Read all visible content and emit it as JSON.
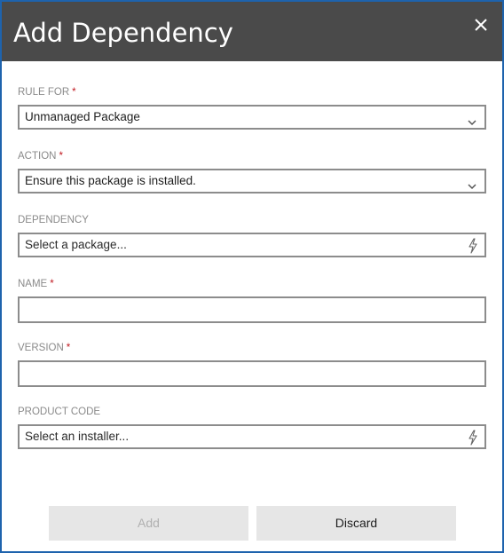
{
  "dialog": {
    "title": "Add Dependency",
    "close_icon": "close-icon"
  },
  "fields": {
    "rule_for": {
      "label": "RULE FOR",
      "required": "*",
      "value": "Unmanaged Package",
      "icon": "chevron-down-icon"
    },
    "action": {
      "label": "ACTION",
      "required": "*",
      "value": "Ensure this package is installed.",
      "icon": "chevron-down-icon"
    },
    "dependency": {
      "label": "DEPENDENCY",
      "value": "Select a package...",
      "icon": "lightning-bolt-icon"
    },
    "name": {
      "label": "NAME",
      "required": "*",
      "value": ""
    },
    "version": {
      "label": "VERSION",
      "required": "*",
      "value": ""
    },
    "product_code": {
      "label": "PRODUCT CODE",
      "value": "Select an installer...",
      "icon": "lightning-bolt-icon"
    }
  },
  "buttons": {
    "add_label": "Add",
    "discard_label": "Discard"
  },
  "colors": {
    "titlebar": "#4a4a4a",
    "border": "#1e63ad",
    "required": "#c0181f",
    "button_bg": "#e6e6e6"
  }
}
